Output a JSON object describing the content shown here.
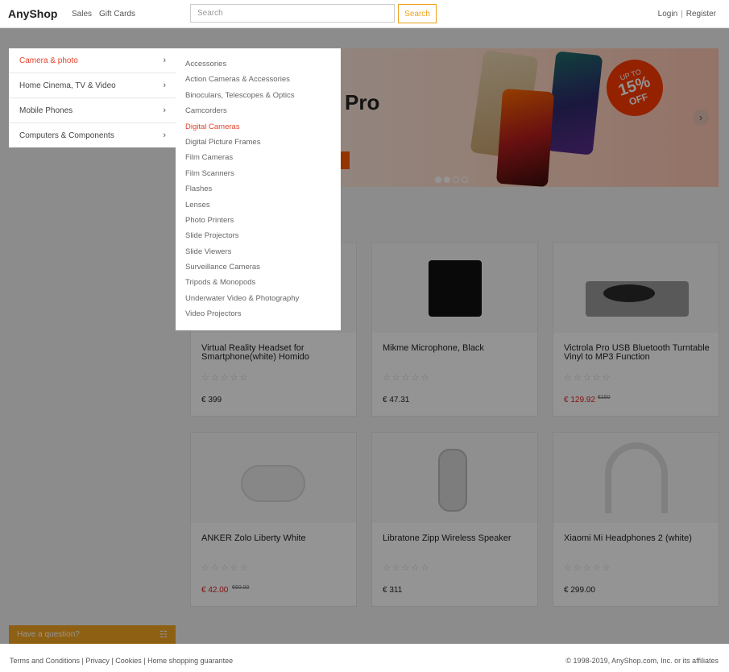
{
  "header": {
    "logo": "AnyShop",
    "nav": [
      "Sales",
      "Gift Cards"
    ],
    "search_placeholder": "Search",
    "search_button": "Search",
    "login": "Login",
    "separator": "|",
    "register": "Register"
  },
  "banner": {
    "title": "Pro",
    "badge_up": "UP TO",
    "badge_percent": "15%",
    "badge_off": "OFF",
    "next_icon": "chevron-right-icon"
  },
  "categories": [
    {
      "label": "Camera & photo",
      "active": true
    },
    {
      "label": "Home Cinema, TV & Video",
      "active": false
    },
    {
      "label": "Mobile Phones",
      "active": false
    },
    {
      "label": "Computers & Components",
      "active": false
    }
  ],
  "subcategories": [
    "Accessories",
    "Action Cameras & Accessories",
    "Binoculars, Telescopes & Optics",
    "Camcorders",
    "Digital Cameras",
    "Digital Picture Frames",
    "Film Cameras",
    "Film Scanners",
    "Flashes",
    "Lenses",
    "Photo Printers",
    "Slide Projectors",
    "Slide Viewers",
    "Surveillance Cameras",
    "Tripods & Monopods",
    "Underwater Video & Photography",
    "Video Projectors"
  ],
  "active_subcategory": "Digital Cameras",
  "products": [
    {
      "name": "Virtual Reality Headset for Smartphone(white) Homido",
      "rating": "☆☆☆☆☆",
      "price": "€ 399",
      "old_price": "",
      "sale": false
    },
    {
      "name": "Mikme Microphone, Black",
      "rating": "☆☆☆☆☆",
      "price": "€ 47.31",
      "old_price": "",
      "sale": false
    },
    {
      "name": "Victrola Pro USB Bluetooth Turntable Vinyl to MP3 Function",
      "rating": "☆☆☆☆☆",
      "price": "€ 129.92",
      "old_price": "€150",
      "sale": true
    },
    {
      "name": "ANKER Zolo Liberty White",
      "rating": "☆☆☆☆☆",
      "price": "€ 42.00",
      "old_price": "€60.00",
      "sale": true
    },
    {
      "name": "Libratone Zipp Wireless Speaker",
      "rating": "☆☆☆☆☆",
      "price": "€ 311",
      "old_price": "",
      "sale": false
    },
    {
      "name": "Xiaomi Mi Headphones 2 (white)",
      "rating": "☆☆☆☆☆",
      "price": "€ 299.00",
      "old_price": "",
      "sale": false
    }
  ],
  "question_bar": {
    "label": "Have a question?",
    "icon": "chat-icon"
  },
  "footer": {
    "links": "Terms and Conditions | Privacy | Cookies | Home shopping guarantee",
    "copyright": "© 1998-2019, AnyShop.com, Inc. or its affiliates"
  },
  "colors": {
    "accent": "#f0a11c",
    "active": "#e5422b",
    "sale": "#e02222"
  }
}
